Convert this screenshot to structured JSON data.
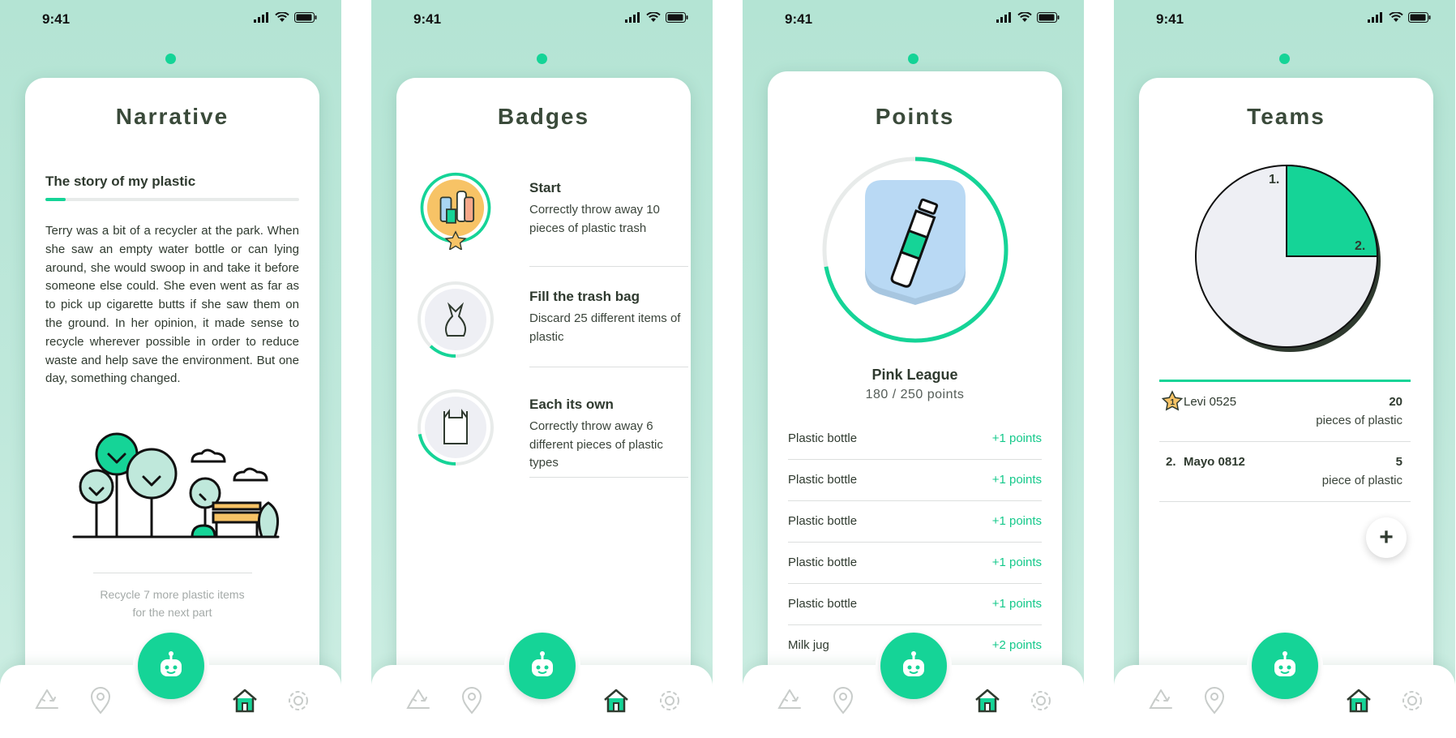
{
  "status": {
    "time": "9:41"
  },
  "colors": {
    "accent": "#15d497",
    "background": "#b4e4d4",
    "text": "#2f3a2f"
  },
  "nav": {
    "items": [
      "recycle-icon",
      "location-pin-icon",
      "robot-icon",
      "home-icon",
      "gear-icon"
    ],
    "active": "home-icon"
  },
  "narrative": {
    "title": "Narrative",
    "subtitle": "The story of my plastic",
    "progress": 0.08,
    "story": "Terry was a bit of a recycler at the park. When she saw an empty water bottle or can lying around, she would swoop in and take it before someone else could. She even went as far as to pick up cigarette butts if she saw them on the ground. In her opinion, it made sense to recycle wherever possible in order to reduce waste and help save the environment. But one day, something changed.",
    "footer_line1": "Recycle 7 more plastic items",
    "footer_line2": "for the next part"
  },
  "badges": {
    "title": "Badges",
    "items": [
      {
        "title": "Start",
        "description": "Correctly throw away 10 pieces of plastic trash",
        "icon": "plastic-bottles-icon",
        "progress": 1.0,
        "earned": true
      },
      {
        "title": "Fill the trash bag",
        "description": "Discard 25 different items of plastic",
        "icon": "trash-bag-icon",
        "progress": 0.12,
        "earned": false
      },
      {
        "title": "Each its own",
        "description": "Correctly throw away 6 different pieces of plastic types",
        "icon": "plastic-bag-icon",
        "progress": 0.22,
        "earned": false
      }
    ]
  },
  "points": {
    "title": "Points",
    "league": "Pink League",
    "total": "180 / 250 points",
    "progress": 0.72,
    "items": [
      {
        "name": "Plastic bottle",
        "value": "+1 points"
      },
      {
        "name": "Plastic bottle",
        "value": "+1 points"
      },
      {
        "name": "Plastic bottle",
        "value": "+1 points"
      },
      {
        "name": "Plastic bottle",
        "value": "+1 points"
      },
      {
        "name": "Plastic bottle",
        "value": "+1 points"
      },
      {
        "name": "Milk jug",
        "value": "+2 points"
      }
    ]
  },
  "teams": {
    "title": "Teams",
    "pie_labels": [
      "1.",
      "2."
    ],
    "pie_share_second": 0.25,
    "rows": [
      {
        "rank": "1",
        "name": "Levi 0525",
        "count": "20",
        "unit": "pieces of plastic"
      },
      {
        "rank": "2.",
        "name": "Mayo 0812",
        "count": "5",
        "unit": "piece of plastic"
      }
    ],
    "add_label": "+"
  }
}
